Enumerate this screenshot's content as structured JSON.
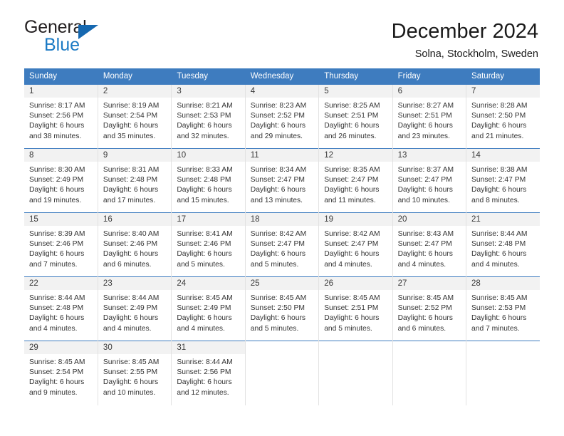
{
  "brand": {
    "name_top": "General",
    "name_bottom": "Blue",
    "triangle_color": "#1668b0",
    "blue_text_color": "#1b7ac4"
  },
  "header": {
    "title": "December 2024",
    "subtitle": "Solna, Stockholm, Sweden",
    "header_bg": "#3e7cbf",
    "header_text": "#ffffff"
  },
  "weekdays": [
    "Sunday",
    "Monday",
    "Tuesday",
    "Wednesday",
    "Thursday",
    "Friday",
    "Saturday"
  ],
  "calendar": {
    "month": "December",
    "year": "2024",
    "location": "Solna, Stockholm, Sweden",
    "weeks": [
      [
        {
          "day": "1",
          "sunrise": "Sunrise: 8:17 AM",
          "sunset": "Sunset: 2:56 PM",
          "daylight1": "Daylight: 6 hours",
          "daylight2": "and 38 minutes."
        },
        {
          "day": "2",
          "sunrise": "Sunrise: 8:19 AM",
          "sunset": "Sunset: 2:54 PM",
          "daylight1": "Daylight: 6 hours",
          "daylight2": "and 35 minutes."
        },
        {
          "day": "3",
          "sunrise": "Sunrise: 8:21 AM",
          "sunset": "Sunset: 2:53 PM",
          "daylight1": "Daylight: 6 hours",
          "daylight2": "and 32 minutes."
        },
        {
          "day": "4",
          "sunrise": "Sunrise: 8:23 AM",
          "sunset": "Sunset: 2:52 PM",
          "daylight1": "Daylight: 6 hours",
          "daylight2": "and 29 minutes."
        },
        {
          "day": "5",
          "sunrise": "Sunrise: 8:25 AM",
          "sunset": "Sunset: 2:51 PM",
          "daylight1": "Daylight: 6 hours",
          "daylight2": "and 26 minutes."
        },
        {
          "day": "6",
          "sunrise": "Sunrise: 8:27 AM",
          "sunset": "Sunset: 2:51 PM",
          "daylight1": "Daylight: 6 hours",
          "daylight2": "and 23 minutes."
        },
        {
          "day": "7",
          "sunrise": "Sunrise: 8:28 AM",
          "sunset": "Sunset: 2:50 PM",
          "daylight1": "Daylight: 6 hours",
          "daylight2": "and 21 minutes."
        }
      ],
      [
        {
          "day": "8",
          "sunrise": "Sunrise: 8:30 AM",
          "sunset": "Sunset: 2:49 PM",
          "daylight1": "Daylight: 6 hours",
          "daylight2": "and 19 minutes."
        },
        {
          "day": "9",
          "sunrise": "Sunrise: 8:31 AM",
          "sunset": "Sunset: 2:48 PM",
          "daylight1": "Daylight: 6 hours",
          "daylight2": "and 17 minutes."
        },
        {
          "day": "10",
          "sunrise": "Sunrise: 8:33 AM",
          "sunset": "Sunset: 2:48 PM",
          "daylight1": "Daylight: 6 hours",
          "daylight2": "and 15 minutes."
        },
        {
          "day": "11",
          "sunrise": "Sunrise: 8:34 AM",
          "sunset": "Sunset: 2:47 PM",
          "daylight1": "Daylight: 6 hours",
          "daylight2": "and 13 minutes."
        },
        {
          "day": "12",
          "sunrise": "Sunrise: 8:35 AM",
          "sunset": "Sunset: 2:47 PM",
          "daylight1": "Daylight: 6 hours",
          "daylight2": "and 11 minutes."
        },
        {
          "day": "13",
          "sunrise": "Sunrise: 8:37 AM",
          "sunset": "Sunset: 2:47 PM",
          "daylight1": "Daylight: 6 hours",
          "daylight2": "and 10 minutes."
        },
        {
          "day": "14",
          "sunrise": "Sunrise: 8:38 AM",
          "sunset": "Sunset: 2:47 PM",
          "daylight1": "Daylight: 6 hours",
          "daylight2": "and 8 minutes."
        }
      ],
      [
        {
          "day": "15",
          "sunrise": "Sunrise: 8:39 AM",
          "sunset": "Sunset: 2:46 PM",
          "daylight1": "Daylight: 6 hours",
          "daylight2": "and 7 minutes."
        },
        {
          "day": "16",
          "sunrise": "Sunrise: 8:40 AM",
          "sunset": "Sunset: 2:46 PM",
          "daylight1": "Daylight: 6 hours",
          "daylight2": "and 6 minutes."
        },
        {
          "day": "17",
          "sunrise": "Sunrise: 8:41 AM",
          "sunset": "Sunset: 2:46 PM",
          "daylight1": "Daylight: 6 hours",
          "daylight2": "and 5 minutes."
        },
        {
          "day": "18",
          "sunrise": "Sunrise: 8:42 AM",
          "sunset": "Sunset: 2:47 PM",
          "daylight1": "Daylight: 6 hours",
          "daylight2": "and 5 minutes."
        },
        {
          "day": "19",
          "sunrise": "Sunrise: 8:42 AM",
          "sunset": "Sunset: 2:47 PM",
          "daylight1": "Daylight: 6 hours",
          "daylight2": "and 4 minutes."
        },
        {
          "day": "20",
          "sunrise": "Sunrise: 8:43 AM",
          "sunset": "Sunset: 2:47 PM",
          "daylight1": "Daylight: 6 hours",
          "daylight2": "and 4 minutes."
        },
        {
          "day": "21",
          "sunrise": "Sunrise: 8:44 AM",
          "sunset": "Sunset: 2:48 PM",
          "daylight1": "Daylight: 6 hours",
          "daylight2": "and 4 minutes."
        }
      ],
      [
        {
          "day": "22",
          "sunrise": "Sunrise: 8:44 AM",
          "sunset": "Sunset: 2:48 PM",
          "daylight1": "Daylight: 6 hours",
          "daylight2": "and 4 minutes."
        },
        {
          "day": "23",
          "sunrise": "Sunrise: 8:44 AM",
          "sunset": "Sunset: 2:49 PM",
          "daylight1": "Daylight: 6 hours",
          "daylight2": "and 4 minutes."
        },
        {
          "day": "24",
          "sunrise": "Sunrise: 8:45 AM",
          "sunset": "Sunset: 2:49 PM",
          "daylight1": "Daylight: 6 hours",
          "daylight2": "and 4 minutes."
        },
        {
          "day": "25",
          "sunrise": "Sunrise: 8:45 AM",
          "sunset": "Sunset: 2:50 PM",
          "daylight1": "Daylight: 6 hours",
          "daylight2": "and 5 minutes."
        },
        {
          "day": "26",
          "sunrise": "Sunrise: 8:45 AM",
          "sunset": "Sunset: 2:51 PM",
          "daylight1": "Daylight: 6 hours",
          "daylight2": "and 5 minutes."
        },
        {
          "day": "27",
          "sunrise": "Sunrise: 8:45 AM",
          "sunset": "Sunset: 2:52 PM",
          "daylight1": "Daylight: 6 hours",
          "daylight2": "and 6 minutes."
        },
        {
          "day": "28",
          "sunrise": "Sunrise: 8:45 AM",
          "sunset": "Sunset: 2:53 PM",
          "daylight1": "Daylight: 6 hours",
          "daylight2": "and 7 minutes."
        }
      ],
      [
        {
          "day": "29",
          "sunrise": "Sunrise: 8:45 AM",
          "sunset": "Sunset: 2:54 PM",
          "daylight1": "Daylight: 6 hours",
          "daylight2": "and 9 minutes."
        },
        {
          "day": "30",
          "sunrise": "Sunrise: 8:45 AM",
          "sunset": "Sunset: 2:55 PM",
          "daylight1": "Daylight: 6 hours",
          "daylight2": "and 10 minutes."
        },
        {
          "day": "31",
          "sunrise": "Sunrise: 8:44 AM",
          "sunset": "Sunset: 2:56 PM",
          "daylight1": "Daylight: 6 hours",
          "daylight2": "and 12 minutes."
        },
        {
          "day": "",
          "sunrise": "",
          "sunset": "",
          "daylight1": "",
          "daylight2": ""
        },
        {
          "day": "",
          "sunrise": "",
          "sunset": "",
          "daylight1": "",
          "daylight2": ""
        },
        {
          "day": "",
          "sunrise": "",
          "sunset": "",
          "daylight1": "",
          "daylight2": ""
        },
        {
          "day": "",
          "sunrise": "",
          "sunset": "",
          "daylight1": "",
          "daylight2": ""
        }
      ]
    ]
  }
}
